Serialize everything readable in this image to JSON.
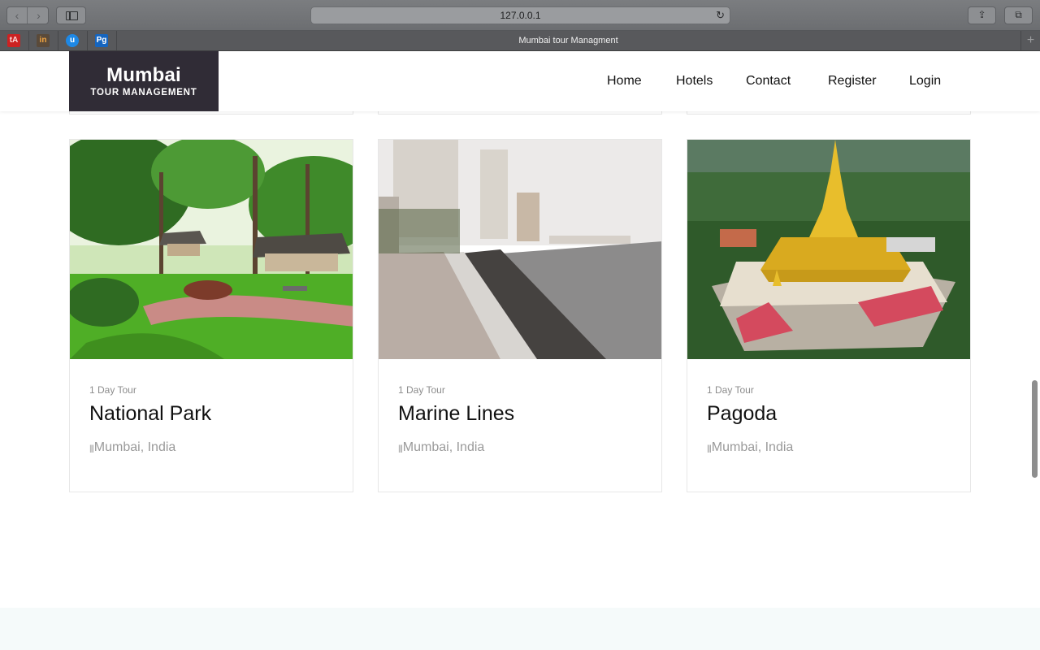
{
  "browser": {
    "url": "127.0.0.1",
    "tab_title": "Mumbai tour Managment",
    "favicons": [
      "tA",
      "in",
      "u",
      "Pg"
    ],
    "new_tab": "+"
  },
  "site": {
    "logo_line1": "Mumbai",
    "logo_line2": "TOUR MANAGEMENT",
    "nav": [
      "Home",
      "Hotels",
      "Contact",
      "Register",
      "Login"
    ]
  },
  "tours": [
    {
      "duration": "1 Day Tour",
      "title": "National Park",
      "location": "Mumbai, India",
      "image": "park-photo"
    },
    {
      "duration": "1 Day Tour",
      "title": "Marine Lines",
      "location": "Mumbai, India",
      "image": "seafront-photo"
    },
    {
      "duration": "1 Day Tour",
      "title": "Pagoda",
      "location": "Mumbai, India",
      "image": "pagoda-photo"
    }
  ],
  "colors": {
    "logo_bg": "#302c36",
    "footer_bg": "#f5fafa",
    "muted_text": "#9a9a9a"
  }
}
